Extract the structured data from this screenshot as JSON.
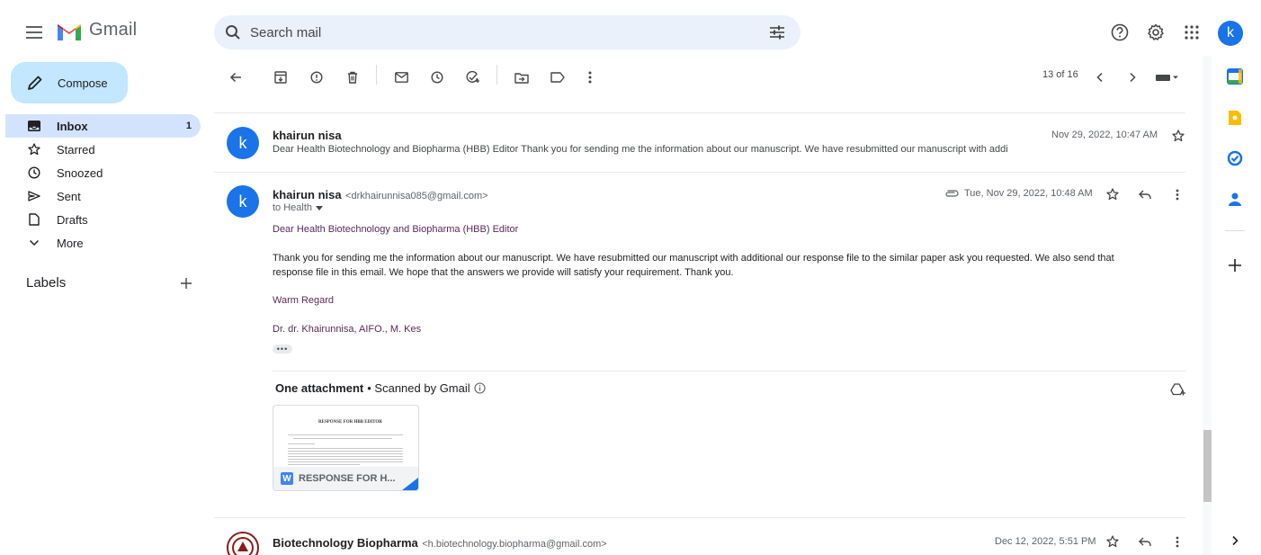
{
  "header": {
    "app_name": "Gmail",
    "search_placeholder": "Search mail",
    "avatar_letter": "k"
  },
  "sidebar": {
    "compose_label": "Compose",
    "items": [
      {
        "label": "Inbox",
        "count": "1",
        "icon": "inbox-icon"
      },
      {
        "label": "Starred",
        "count": "",
        "icon": "star-icon"
      },
      {
        "label": "Snoozed",
        "count": "",
        "icon": "clock-icon"
      },
      {
        "label": "Sent",
        "count": "",
        "icon": "send-icon"
      },
      {
        "label": "Drafts",
        "count": "",
        "icon": "draft-icon"
      },
      {
        "label": "More",
        "count": "",
        "icon": "chevron-down-icon"
      }
    ],
    "labels_title": "Labels"
  },
  "toolbar": {
    "pager": "13 of 16"
  },
  "collapsed_message": {
    "avatar_letter": "k",
    "sender": "khairun nisa",
    "date": "Nov 29, 2022, 10:47 AM",
    "snippet": "Dear Health Biotechnology and Biopharma (HBB) Editor Thank you for sending me the information about our manuscript. We have resubmitted our manuscript with addi"
  },
  "open_message": {
    "avatar_letter": "k",
    "sender": "khairun nisa",
    "sender_email": "<drkhairunnisa085@gmail.com>",
    "to_line": "to Health",
    "date": "Tue, Nov 29, 2022, 10:48 AM",
    "greeting": "Dear Health Biotechnology and Biopharma (HBB) Editor",
    "body_line1": "Thank you for sending me the information about our manuscript. We have resubmitted our manuscript with additional our response file to the similar paper ask you requested. We also send that",
    "body_line2": "response file in this email. We hope that the answers we provide will satisfy your requirement. Thank you.",
    "closing": "Warm Regard",
    "signature": "Dr. dr. Khairunnisa, AIFO., M. Kes",
    "dots": "•••",
    "attachment_count": "One attachment",
    "scanned_text": " •  Scanned by Gmail",
    "attachment_name": "RESPONSE FOR H...",
    "thumb_title": "RESPONSE FOR HBB EDITOR",
    "file_badge": "W"
  },
  "next_message": {
    "sender": "Biotechnology Biopharma",
    "sender_email": "<h.biotechnology.biopharma@gmail.com>",
    "date": "Dec 12, 2022, 5:51 PM"
  },
  "colors": {
    "accent": "#1a73e8",
    "compose_bg": "#c2e7ff",
    "active_nav": "#d3e3fd",
    "search_bg": "#eaf1fb",
    "body_text": "#5a2a58"
  }
}
